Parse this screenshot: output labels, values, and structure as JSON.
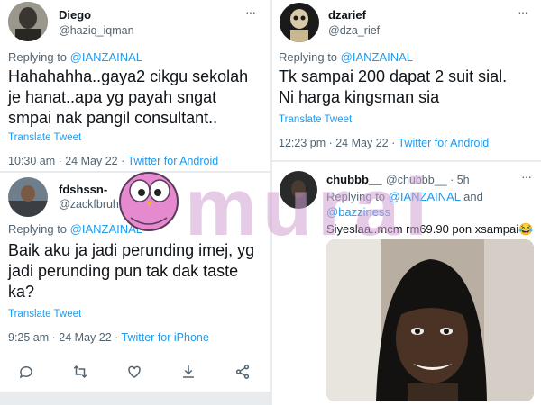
{
  "tweet1": {
    "name": "Diego",
    "handle": "@haziq_iqman",
    "replying_prefix": "Replying to ",
    "replying_to": "@IANZAINAL",
    "text": "Hahahahha..gaya2 cikgu sekolah\nje hanat..apa yg payah sngat\nsmpai nak pangil consultant..",
    "translate": "Translate Tweet",
    "time": "10:30 am · 24 May 22 · ",
    "source": "Twitter for Android"
  },
  "tweet2": {
    "name": "fdshssn-",
    "handle": "@zackfbruhl1",
    "replying_prefix": "Replying to ",
    "replying_to": "@IANZAINAL",
    "text": "Baik aku ja jadi perunding imej, yg\njadi perunding pun tak dak taste\nka?",
    "translate": "Translate Tweet",
    "time": "9:25 am · 24 May 22 · ",
    "source": "Twitter for iPhone"
  },
  "tweet3": {
    "name": "dzarief",
    "handle": "@dza_rief",
    "replying_prefix": "Replying to ",
    "replying_to": "@IANZAINAL",
    "text": "Tk sampai 200 dapat 2 suit sial.\nNi harga kingsman sia",
    "translate": "Translate Tweet",
    "time": "12:23 pm · 24 May 22 · ",
    "source": "Twitter for Android"
  },
  "tweet4": {
    "name": "chubbb__",
    "handle": "@chubbb__",
    "age": "· 5h",
    "replying_prefix": "Replying to ",
    "replying_to": "@IANZAINAL",
    "replying_and": " and",
    "replying_to2": "@bazziness",
    "text": "Siyeslaa..mcm rm69.90 pon xsampai😂"
  },
  "more_icon": "more-horizontal-icon",
  "watermark": "murai",
  "colors": {
    "link": "#1d9bf0",
    "muted": "#536471",
    "watermark": "#d2a0d2"
  }
}
